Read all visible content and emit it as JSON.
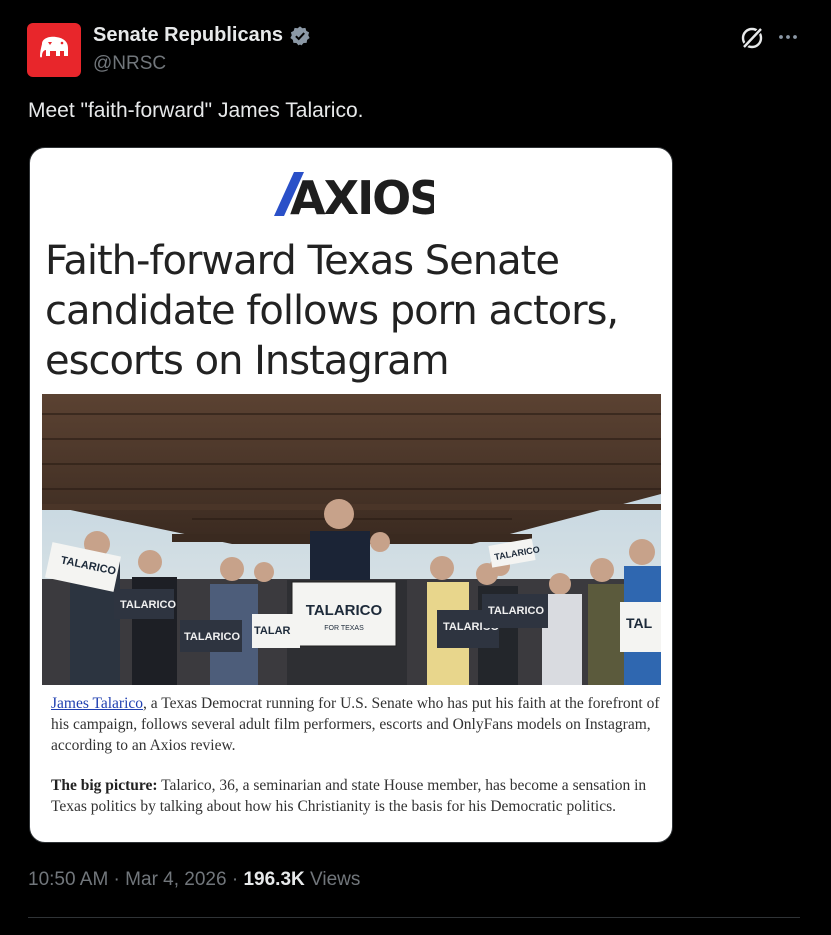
{
  "author": {
    "name": "Senate Republicans",
    "handle": "@NRSC",
    "verified": true,
    "avatar_icon": "elephant-icon",
    "avatar_color": "#e8262b"
  },
  "post": {
    "text": "Meet \"faith-forward\" James Talarico."
  },
  "card": {
    "logo_text": "AXIOS",
    "headline": "Faith-forward Texas Senate candidate follows porn actors, escorts on Instagram",
    "photo_signs": [
      "TALARICO",
      "FOR TEXAS",
      "TALARICO",
      "TALARICO",
      "TALARICO",
      "TALARICO",
      "TALARICO",
      "TALARICO",
      "TAL",
      "TALAR"
    ],
    "caption_link": "James Talarico",
    "caption_rest": ", a Texas Democrat running for U.S. Senate who has put his faith at the forefront of his campaign, follows several adult film performers, escorts and OnlyFans models on Instagram, according to an Axios review.",
    "bigpicture_label": "The big picture:",
    "bigpicture_text": " Talarico, 36, a seminarian and state House member, has become a sensation in Texas politics by talking about how his Christianity is the basis for his Democratic politics."
  },
  "meta": {
    "time": "10:50 AM",
    "separator1": " · ",
    "date": "Mar 4, 2026",
    "separator2": " · ",
    "views_count": "196.3K",
    "views_label": " Views"
  },
  "icons": {
    "grok": "grok-icon",
    "more": "more-icon",
    "verified": "verified-badge-icon"
  },
  "colors": {
    "background": "#000000",
    "text": "#e7e9ea",
    "muted": "#71767b",
    "axios_blue": "#2a50c8",
    "axios_black": "#1e1e1e",
    "link": "#1f3fb0"
  }
}
